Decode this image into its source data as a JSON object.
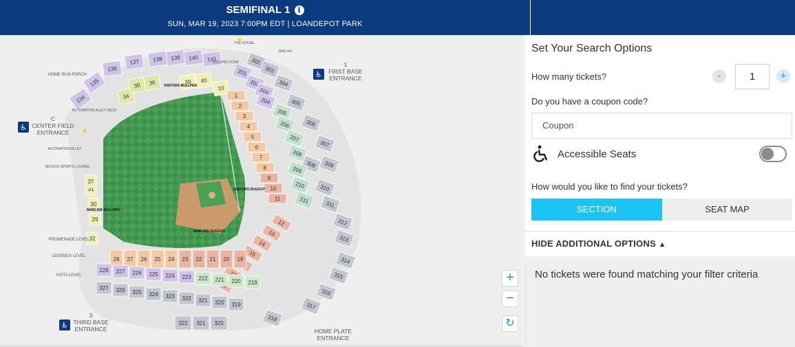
{
  "header": {
    "title": "SEMIFINAL 1",
    "info_icon": "info-icon",
    "subtitle": "SUN, MAR 19, 2023 7:00PM EDT | LOANDEPOT PARK"
  },
  "map": {
    "entrances": {
      "first_base": {
        "num": "1",
        "line1": "FIRST BASE",
        "line2": "ENTRANCE"
      },
      "center_field": {
        "num": "C",
        "line1": "CENTER FIELD",
        "line2": "ENTRANCE"
      },
      "third_base": {
        "num": "3",
        "line1": "THIRD BASE",
        "line2": "ENTRANCE"
      },
      "home_plate": {
        "line1": "HOME PLATE",
        "line2": "ENTRANCE"
      }
    },
    "labels": {
      "home_run_porch": "HOME RUN PORCH",
      "the_social": "THE SOCIAL",
      "bar_441": "BAR 441",
      "bullpen_zone": "BULLPEN ZONE",
      "visitors_bullpen": "VISITORS BULLPEN",
      "automation_alley_deck": "AUTONATION ALLEY DECK",
      "automation_alley": "AUTONATION ALLEY",
      "recess_lounge": "RECESS SPORTS LOUNGE",
      "promenade": "PROMENADE LEVEL",
      "legends": "LEGENDS LEVEL",
      "vista": "VISTA LEVEL",
      "marlins_dugout": "MARLINS DUGOUT",
      "visitors_dugout": "VISITORS DUGOUT",
      "marlins_bullpen": "MARLINS BULLPEN"
    },
    "sections": {
      "upper_left": [
        "136",
        "137",
        "138",
        "139",
        "140",
        "141",
        "135",
        "134"
      ],
      "bleachers": [
        "34",
        "35",
        "36",
        "39",
        "40",
        "33"
      ],
      "top_right_small": [
        "302",
        "303",
        "201",
        "202",
        "203",
        "204",
        "304",
        "305",
        "205",
        "206",
        "306",
        "307",
        "207",
        "208",
        "308",
        "209",
        "309",
        "210",
        "211",
        "310",
        "311",
        "312",
        "313",
        "314",
        "315",
        "316",
        "317",
        "318"
      ],
      "field_level_right": [
        "1",
        "2",
        "3",
        "4",
        "5",
        "6",
        "7",
        "8",
        "9",
        "10",
        "11",
        "12",
        "13",
        "14",
        "15",
        "16",
        "17",
        "18"
      ],
      "home_row": [
        "19",
        "20",
        "21",
        "22",
        "23",
        "24",
        "25",
        "26",
        "27",
        "28"
      ],
      "left_lower": [
        "29",
        "30",
        "31",
        "32",
        "37"
      ],
      "vista_left": [
        "228",
        "227",
        "226",
        "225",
        "224",
        "223",
        "222",
        "221",
        "220",
        "219",
        "327",
        "326",
        "325",
        "324",
        "323",
        "322",
        "321",
        "320",
        "319"
      ],
      "bottom": [
        "322",
        "321",
        "320"
      ]
    },
    "zoom_in": "+",
    "zoom_out": "−",
    "reset_icon": "refresh-icon"
  },
  "panel": {
    "title": "Set Your Search Options",
    "tickets_question": "How many tickets?",
    "minus": "-",
    "plus": "+",
    "ticket_count": "1",
    "coupon_question": "Do you have a coupon code?",
    "coupon_placeholder": "Coupon",
    "accessible_label": "Accessible Seats",
    "accessible_icon": "wheelchair-icon",
    "find_question": "How would you like to find your tickets?",
    "tab_section": "SECTION",
    "tab_seatmap": "SEAT MAP",
    "hide_options": "HIDE ADDITIONAL OPTIONS",
    "no_results": "No tickets were found matching your filter criteria",
    "accent_color": "#1ec3f5",
    "header_color": "#0b3a7e"
  }
}
